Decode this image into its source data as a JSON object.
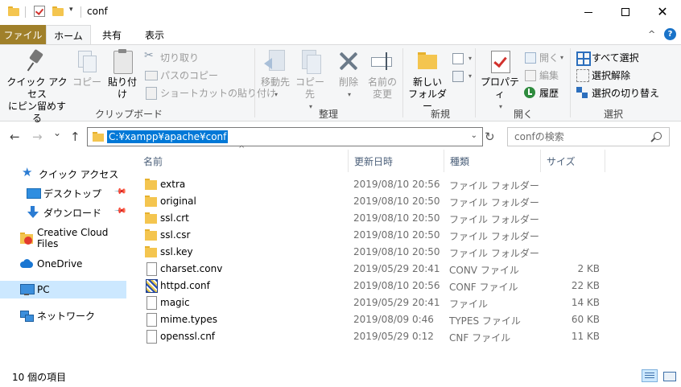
{
  "window": {
    "title": "conf",
    "minimize": "",
    "maximize": "",
    "close": "✕"
  },
  "quick_access_toolbar": {
    "dropdown": "▾"
  },
  "ribbon_tabs": {
    "file": "ファイル",
    "home": "ホーム",
    "share": "共有",
    "view": "表示",
    "collapse": "^",
    "help": "?"
  },
  "ribbon": {
    "clipboard": {
      "label": "クリップボード",
      "pin_line1": "クイック アクセス",
      "pin_line2": "にピン留めする",
      "copy": "コピー",
      "paste": "貼り付け",
      "cut": "切り取り",
      "copy_path": "パスのコピー",
      "paste_shortcut": "ショートカットの貼り付け"
    },
    "organize": {
      "label": "整理",
      "move_to": "移動先",
      "copy_to": "コピー先",
      "delete": "削除",
      "rename_line1": "名前の",
      "rename_line2": "変更"
    },
    "new": {
      "label": "新規",
      "new_folder_line1": "新しい",
      "new_folder_line2": "フォルダー"
    },
    "open": {
      "label": "開く",
      "properties": "プロパティ",
      "open": "開く",
      "edit": "編集",
      "history": "履歴"
    },
    "select": {
      "label": "選択",
      "select_all": "すべて選択",
      "select_none": "選択解除",
      "invert": "選択の切り替え"
    }
  },
  "address_bar": {
    "back": "←",
    "forward": "→",
    "recent": "⌄",
    "up": "↑",
    "path": "C:¥xampp¥apache¥conf",
    "dropdown": "⌄",
    "refresh": "↻",
    "search_placeholder": "confの検索"
  },
  "nav_pane": {
    "items": [
      {
        "label": "クイック アクセス"
      },
      {
        "label": "デスクトップ"
      },
      {
        "label": "ダウンロード"
      },
      {
        "label": "Creative Cloud Files"
      },
      {
        "label": "OneDrive"
      },
      {
        "label": "PC"
      },
      {
        "label": "ネットワーク"
      }
    ]
  },
  "file_list": {
    "columns": {
      "name": "名前",
      "date": "更新日時",
      "type": "種類",
      "size": "サイズ",
      "sort_indicator": "^"
    },
    "rows": [
      {
        "name": "extra",
        "date": "2019/08/10 20:56",
        "type": "ファイル フォルダー",
        "size": "",
        "icon": "folder-icon"
      },
      {
        "name": "original",
        "date": "2019/08/10 20:50",
        "type": "ファイル フォルダー",
        "size": "",
        "icon": "folder-icon"
      },
      {
        "name": "ssl.crt",
        "date": "2019/08/10 20:50",
        "type": "ファイル フォルダー",
        "size": "",
        "icon": "folder-icon"
      },
      {
        "name": "ssl.csr",
        "date": "2019/08/10 20:50",
        "type": "ファイル フォルダー",
        "size": "",
        "icon": "folder-icon"
      },
      {
        "name": "ssl.key",
        "date": "2019/08/10 20:50",
        "type": "ファイル フォルダー",
        "size": "",
        "icon": "folder-icon"
      },
      {
        "name": "charset.conv",
        "date": "2019/05/29 20:41",
        "type": "CONV ファイル",
        "size": "2 KB",
        "icon": "document-icon"
      },
      {
        "name": "httpd.conf",
        "date": "2019/08/10 20:56",
        "type": "CONF ファイル",
        "size": "22 KB",
        "icon": "conf-file-icon"
      },
      {
        "name": "magic",
        "date": "2019/05/29 20:41",
        "type": "ファイル",
        "size": "14 KB",
        "icon": "document-icon"
      },
      {
        "name": "mime.types",
        "date": "2019/08/09 0:46",
        "type": "TYPES ファイル",
        "size": "60 KB",
        "icon": "document-icon"
      },
      {
        "name": "openssl.cnf",
        "date": "2019/05/29 0:12",
        "type": "CNF ファイル",
        "size": "11 KB",
        "icon": "document-icon"
      }
    ]
  },
  "status_bar": {
    "item_count": "10 個の項目"
  },
  "colors": {
    "file_tab": "#a0802a",
    "selection": "#0078d7",
    "nav_selected": "#cce8ff",
    "folder": "#f4c54f"
  }
}
